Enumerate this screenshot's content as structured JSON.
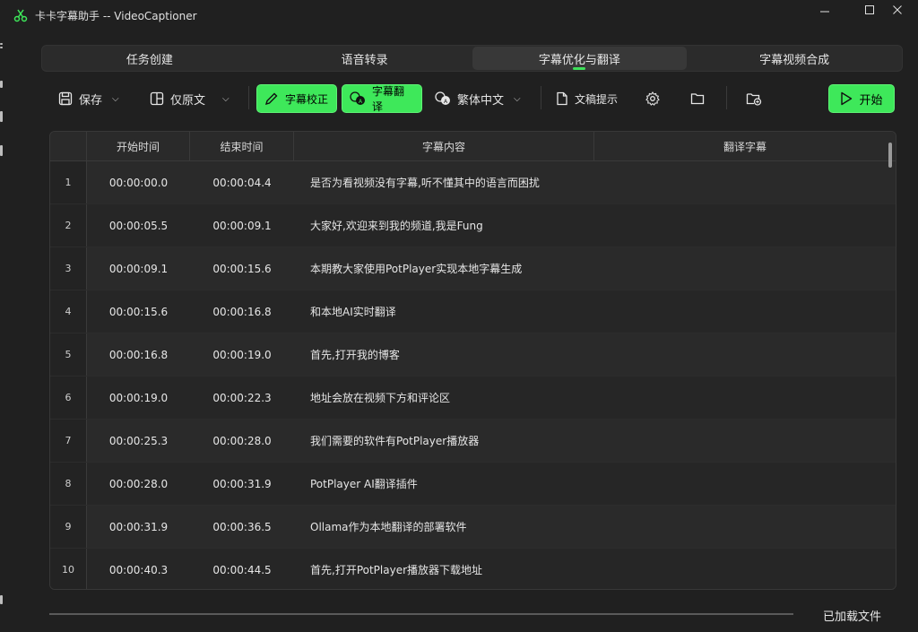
{
  "window": {
    "title": "卡卡字幕助手 -- VideoCaptioner"
  },
  "tabs": [
    {
      "label": "任务创建"
    },
    {
      "label": "语音转录"
    },
    {
      "label": "字幕优化与翻译",
      "active": true
    },
    {
      "label": "字幕视频合成"
    }
  ],
  "toolbar": {
    "save_label": "保存",
    "layout_label": "仅原文",
    "correct_label": "字幕校正",
    "translate_label": "字幕翻译",
    "language_label": "繁体中文",
    "prompt_label": "文稿提示",
    "start_label": "开始"
  },
  "table": {
    "headers": [
      "开始时间",
      "结束时间",
      "字幕内容",
      "翻译字幕"
    ],
    "rows": [
      {
        "num": "1",
        "start": "00:00:00.0",
        "end": "00:00:04.4",
        "text": "是否为看视频没有字幕,听不懂其中的语言而困扰",
        "translation": ""
      },
      {
        "num": "2",
        "start": "00:00:05.5",
        "end": "00:00:09.1",
        "text": "大家好,欢迎来到我的频道,我是Fung",
        "translation": ""
      },
      {
        "num": "3",
        "start": "00:00:09.1",
        "end": "00:00:15.6",
        "text": "本期教大家使用PotPlayer实现本地字幕生成",
        "translation": ""
      },
      {
        "num": "4",
        "start": "00:00:15.6",
        "end": "00:00:16.8",
        "text": "和本地AI实时翻译",
        "translation": ""
      },
      {
        "num": "5",
        "start": "00:00:16.8",
        "end": "00:00:19.0",
        "text": "首先,打开我的博客",
        "translation": ""
      },
      {
        "num": "6",
        "start": "00:00:19.0",
        "end": "00:00:22.3",
        "text": "地址会放在视频下方和评论区",
        "translation": ""
      },
      {
        "num": "7",
        "start": "00:00:25.3",
        "end": "00:00:28.0",
        "text": "我们需要的软件有PotPlayer播放器",
        "translation": ""
      },
      {
        "num": "8",
        "start": "00:00:28.0",
        "end": "00:00:31.9",
        "text": "PotPlayer AI翻译插件",
        "translation": ""
      },
      {
        "num": "9",
        "start": "00:00:31.9",
        "end": "00:00:36.5",
        "text": "Ollama作为本地翻译的部署软件",
        "translation": ""
      },
      {
        "num": "10",
        "start": "00:00:40.3",
        "end": "00:00:44.5",
        "text": "首先,打开PotPlayer播放器下载地址",
        "translation": ""
      }
    ]
  },
  "status": {
    "text": "已加载文件"
  },
  "colors": {
    "accent": "#3ee85a",
    "background": "#202020"
  },
  "icons": [
    "app-icon",
    "minimize-icon",
    "maximize-icon",
    "close-icon",
    "save-icon",
    "layout-icon",
    "pencil-icon",
    "translate-icon",
    "language-icon",
    "document-icon",
    "gear-icon",
    "folder-icon",
    "folder-add-icon",
    "play-icon"
  ]
}
